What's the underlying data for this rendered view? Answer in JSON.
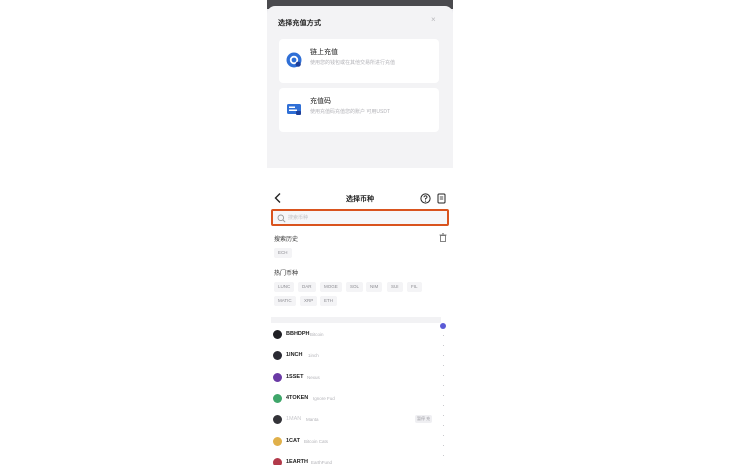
{
  "dialog": {
    "title": "选择充值方式",
    "close_glyph": "×",
    "options": [
      {
        "name": "链上充值",
        "desc": "使用您的钱包或在其他交易所进行充值",
        "icon": "chain-recharge-icon"
      },
      {
        "name": "充值码",
        "desc": "使用充值码充值您的账户 可用USDT",
        "icon": "recharge-code-icon"
      }
    ]
  },
  "panel": {
    "title": "选择币种",
    "search": {
      "placeholder": "搜索币种"
    },
    "history": {
      "title": "搜索历史",
      "chips": [
        "ECH"
      ]
    },
    "hot": {
      "title": "热门币种",
      "chips_row1": [
        "LUNC",
        "DAR",
        "MOGE",
        "SOL",
        "NIM",
        "SUI",
        "FIL"
      ],
      "chips_row2": [
        "MATIC",
        "XRP",
        "ETH"
      ]
    },
    "coins": [
      {
        "symbol": "BBHDPH",
        "name": "Bitcoin",
        "color": "#1f1f24",
        "dim": false
      },
      {
        "symbol": "1INCH",
        "name": "1inch",
        "color": "#2a2a33",
        "dim": false
      },
      {
        "symbol": "1SSET",
        "name": "Nexus",
        "color": "#6a3aa5",
        "dim": false
      },
      {
        "symbol": "4TOKEN",
        "name": "Ignore Fud",
        "color": "#3fa66a",
        "dim": false
      },
      {
        "symbol": "1MAN",
        "name": "Manta",
        "color": "#333338",
        "dim": true,
        "tag": "暂停 充"
      },
      {
        "symbol": "1CAT",
        "name": "Bitcoin Cats",
        "color": "#e0b04a",
        "dim": false
      },
      {
        "symbol": "1EARTH",
        "name": "EarthFund",
        "color": "#b23a4a",
        "dim": false
      }
    ]
  },
  "colors": {
    "accent_border": "#d9531e",
    "index_dot": "#5b5bd6"
  }
}
